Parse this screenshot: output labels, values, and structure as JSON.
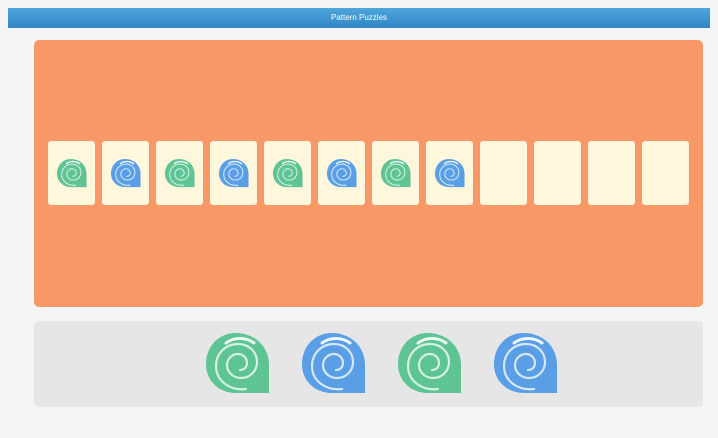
{
  "app": {
    "title": "Pattern Puzzles"
  },
  "colors": {
    "title_bar": "#3b95d0",
    "board": "#f89866",
    "card": "#fff7dc",
    "tray": "#e6e6e6",
    "shell_green": "#5ec494",
    "shell_blue": "#5a9fe6"
  },
  "sequence": {
    "slots": [
      {
        "icon": "green-shell-icon",
        "color": "green"
      },
      {
        "icon": "blue-shell-icon",
        "color": "blue"
      },
      {
        "icon": "green-shell-icon",
        "color": "green"
      },
      {
        "icon": "blue-shell-icon",
        "color": "blue"
      },
      {
        "icon": "green-shell-icon",
        "color": "green"
      },
      {
        "icon": "blue-shell-icon",
        "color": "blue"
      },
      {
        "icon": "green-shell-icon",
        "color": "green"
      },
      {
        "icon": "blue-shell-icon",
        "color": "blue"
      },
      {
        "icon": null,
        "color": null
      },
      {
        "icon": null,
        "color": null
      },
      {
        "icon": null,
        "color": null
      },
      {
        "icon": null,
        "color": null
      }
    ]
  },
  "tray": {
    "pieces": [
      {
        "icon": "green-shell-icon",
        "color": "green"
      },
      {
        "icon": "blue-shell-icon",
        "color": "blue"
      },
      {
        "icon": "green-shell-icon",
        "color": "green"
      },
      {
        "icon": "blue-shell-icon",
        "color": "blue"
      }
    ]
  }
}
